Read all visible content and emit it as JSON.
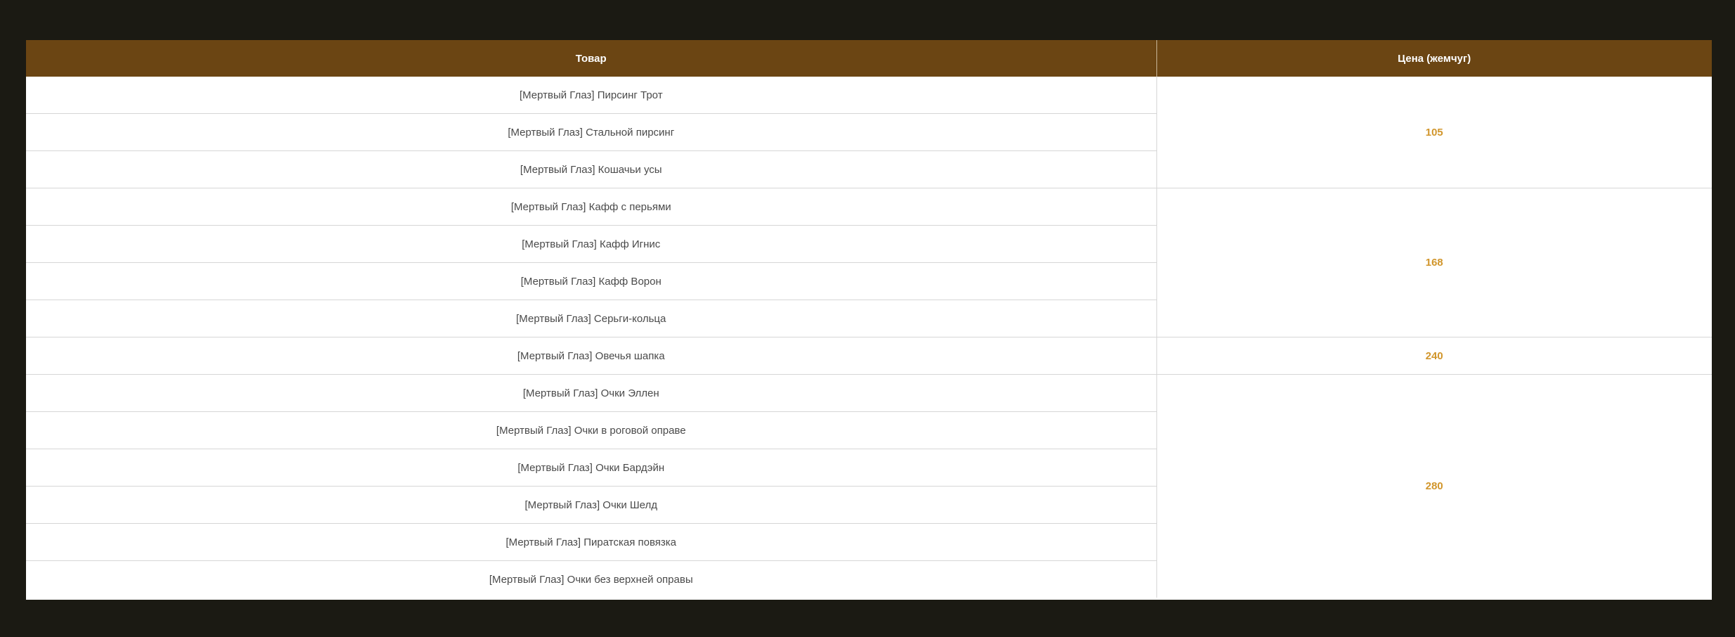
{
  "table": {
    "headers": {
      "item": "Товар",
      "price": "Цена (жемчуг)"
    },
    "groups": [
      {
        "price": "105",
        "items": [
          "[Мертвый Глаз] Пирсинг Трот",
          "[Мертвый Глаз] Стальной пирсинг",
          "[Мертвый Глаз] Кошачьи усы"
        ]
      },
      {
        "price": "168",
        "items": [
          "[Мертвый Глаз] Кафф с перьями",
          "[Мертвый Глаз] Кафф Игнис",
          "[Мертвый Глаз] Кафф Ворон",
          "[Мертвый Глаз] Серьги-кольца"
        ]
      },
      {
        "price": "240",
        "items": [
          "[Мертвый Глаз] Овечья шапка"
        ]
      },
      {
        "price": "280",
        "items": [
          "[Мертвый Глаз] Очки Эллен",
          "[Мертвый Глаз] Очки в роговой оправе",
          "[Мертвый Глаз] Очки Бардэйн",
          "[Мертвый Глаз] Очки Шелд",
          "[Мертвый Глаз] Пиратская повязка",
          "[Мертвый Глаз] Очки без верхней оправы"
        ]
      }
    ]
  },
  "colors": {
    "page_background": "#1b1a13",
    "header_background": "#6b4513",
    "header_text": "#ffffff",
    "price_text": "#d1962c",
    "item_text": "#4a4a4a"
  }
}
